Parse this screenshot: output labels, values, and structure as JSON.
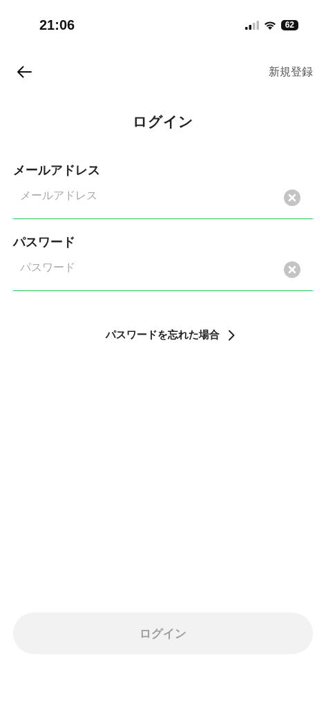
{
  "status_bar": {
    "time": "21:06",
    "battery": "62"
  },
  "nav": {
    "action": "新規登録"
  },
  "title": "ログイン",
  "fields": [
    {
      "label": "メールアドレス",
      "placeholder": "メールアドレス"
    },
    {
      "label": "パスワード",
      "placeholder": "パスワード"
    }
  ],
  "forgot_link": "パスワードを忘れた場合",
  "login_button": {
    "label": "ログイン",
    "disabled": true
  }
}
